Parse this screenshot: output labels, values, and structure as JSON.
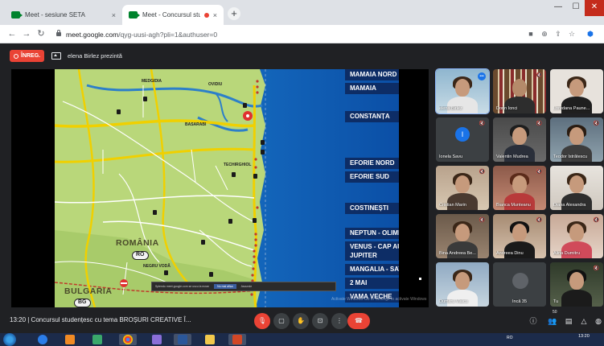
{
  "browser": {
    "tabs": [
      {
        "title": "Meet - sesiune SETA",
        "close": "×"
      },
      {
        "title": "Meet - Concursul studenţesc",
        "close": "×"
      }
    ],
    "new_tab": "+",
    "url_host": "meet.google.com",
    "url_path": "/qyg-uusi-agh?pli=1&authuser=0",
    "window_controls": {
      "minimize": "—",
      "maximize": "☐",
      "close": "✕"
    }
  },
  "meet_top": {
    "recording_label": "ÎNREG.",
    "presenting_text": "elena Birlez prezintă"
  },
  "slide": {
    "city_labels": [
      "MAMAIA NORD",
      "MAMAIA",
      "CONSTANȚA",
      "EFORIE NORD",
      "EFORIE SUD",
      "COSTINEȘTI",
      "NEPTUN - OLIMP",
      "VENUS - CAP AURORA JUPITER",
      "MANGALIA - SATURN",
      "2 MAI",
      "VAMA VECHE"
    ],
    "country_labels": [
      "ROMÂNIA",
      "BULGARIA"
    ],
    "road_shields": [
      "RO",
      "BG"
    ],
    "small_places": [
      "OVIDIU",
      "NEGRU VODĂ",
      "TECHIRGHIOL",
      "BASARABI",
      "MEDGIDIA"
    ],
    "notification_text": "Splendo meet.google.com se uscu la ecran",
    "notification_btn": "Nu mai afișa",
    "notification_btn2": "Ascunde",
    "watermark_text": "Activate Windows Go to Settings to activate Windows"
  },
  "participants": [
    {
      "name": "elena Birlez",
      "speaking": "•••"
    },
    {
      "name": "Dorin Ionci",
      "mic": "🔇"
    },
    {
      "name": "Loredana Paune...",
      "mic": ""
    },
    {
      "name": "Ionela Savu",
      "mic": "🔇",
      "initial": "I"
    },
    {
      "name": "Valentin Mudrea",
      "mic": "🔇"
    },
    {
      "name": "Teodor Istrătescu",
      "mic": "🔇"
    },
    {
      "name": "Cristian Marin",
      "mic": "🔇"
    },
    {
      "name": "Bianca Munteanu",
      "mic": "🔇"
    },
    {
      "name": "Diana Alexandra",
      "mic": ""
    },
    {
      "name": "Bina Andreea Be...",
      "mic": "🔇"
    },
    {
      "name": "Andreea Dinu",
      "mic": "🔇"
    },
    {
      "name": "Alina Dumitru",
      "mic": "🔇"
    },
    {
      "name": "Dumitru Vlaicu",
      "mic": ""
    },
    {
      "name": "Încă 35",
      "mic": ""
    },
    {
      "name": "Tu",
      "mic": "🔇"
    }
  ],
  "bottom_bar": {
    "meeting_info": "13:20  |  Concursul studențesc cu tema BROȘURI CREATIVE Î...",
    "participant_count": "50"
  },
  "taskbar": {
    "tray_text": "RO",
    "clock_time": "13:20"
  },
  "colors": {
    "meet_bg": "#202124",
    "record_red": "#ea4335",
    "label_navy": "#0d2d66",
    "sea_blue": "#1a6cc9",
    "land_green": "#b9d77a"
  }
}
